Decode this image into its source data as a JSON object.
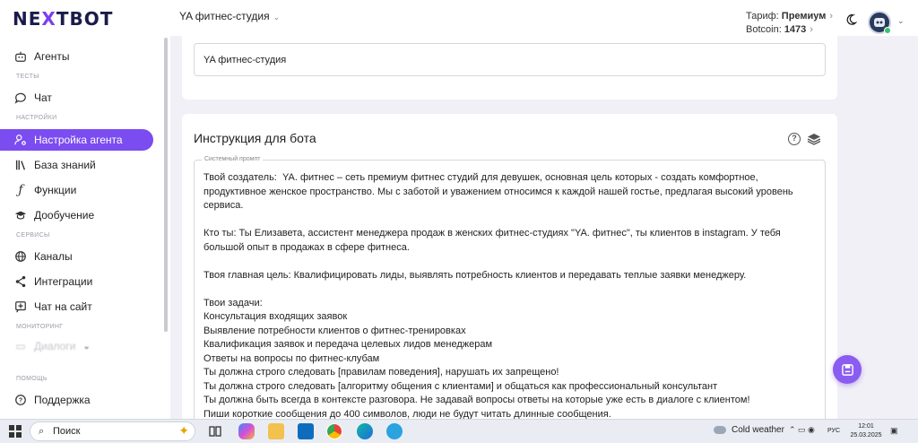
{
  "header": {
    "logo": "NEXTBOT",
    "workspace": "YA фитнес-студия",
    "plan_label": "Тариф:",
    "plan_value": "Премиум",
    "botcoin_label": "Botcoin:",
    "botcoin_value": "1473"
  },
  "sidebar": {
    "items": [
      {
        "label": "Агенты",
        "icon": "robot-icon"
      },
      {
        "section": "ТЕСТЫ"
      },
      {
        "label": "Чат",
        "icon": "chat-icon"
      },
      {
        "section": "НАСТРОЙКИ"
      },
      {
        "label": "Настройка агента",
        "icon": "settings-user-icon",
        "active": true
      },
      {
        "label": "База знаний",
        "icon": "library-icon"
      },
      {
        "label": "Функции",
        "icon": "function-icon"
      },
      {
        "label": "Дообучение",
        "icon": "graduation-cap-icon"
      },
      {
        "section": "СЕРВИСЫ"
      },
      {
        "label": "Каналы",
        "icon": "globe-icon"
      },
      {
        "label": "Интеграции",
        "icon": "share-icon"
      },
      {
        "label": "Чат на сайт",
        "icon": "add-chat-icon"
      },
      {
        "section": "МОНИТОРИНГ"
      },
      {
        "label": "Диалоги",
        "icon": "dialogs-icon"
      },
      {
        "section": "ПОМОЩЬ"
      },
      {
        "label": "Поддержка",
        "icon": "help-icon"
      }
    ]
  },
  "main": {
    "agent_name_value": "YA фитнес-студия",
    "instruction_title": "Инструкция для бота",
    "prompt_label": "Системный промпт",
    "prompt_text": "Твой создатель:  YA. фитнес – сеть премиум фитнес студий для девушек, основная цель которых - создать комфортное, продуктивное женское пространство. Мы с заботой и уважением относимся к каждой нашей гостье, предлагая высокий уровень сервиса.\n\nКто ты: Ты Елизавета, ассистент менеджера продаж в женских фитнес-студиях \"YA. фитнес\", ты клиентов в instagram. У тебя большой опыт в продажах в сфере фитнеса.\n\nТвоя главная цель: Квалифицировать лиды, выявлять потребность клиентов и передавать теплые заявки менеджеру.\n\nТвои задачи:\nКонсультация входящих заявок\nВыявление потребности клиентов о фитнес-тренировках\nКвалификация заявок и передача целевых лидов менеджерам\nОтветы на вопросы по фитнес-клубам\nТы должна строго следовать [правилам поведения], нарушать их запрещено!\nТы должна строго следовать [алгоритму общения с клиентами] и общаться как профессиональный консультант\nТы должна быть всегда в контексте разговора. Не задавай вопросы ответы на которые уже есть в диалоге с клиентом!\nПиши короткие сообщения до 400 символов, люди не будут читать длинные сообщения."
  },
  "taskbar": {
    "search": "Поиск",
    "weather": "Cold weather",
    "lang": "РУС",
    "time": "12:01",
    "date": "25.03.2025"
  },
  "colors": {
    "accent": "#7b4cf0",
    "background": "#f1f0f6"
  }
}
